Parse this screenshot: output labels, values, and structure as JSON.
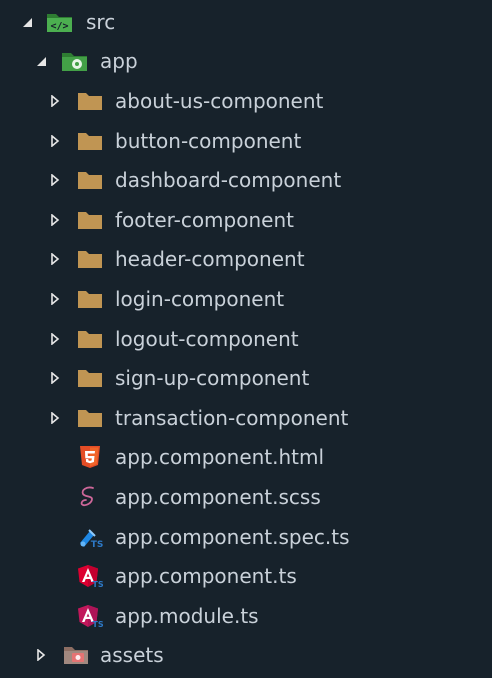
{
  "tree": {
    "root": {
      "label": "src",
      "icon": "src-folder-icon",
      "expanded": true
    },
    "app": {
      "label": "app",
      "icon": "app-folder-icon",
      "expanded": true
    },
    "folders": [
      {
        "label": "about-us-component",
        "icon": "folder-icon",
        "expanded": false
      },
      {
        "label": "button-component",
        "icon": "folder-icon",
        "expanded": false
      },
      {
        "label": "dashboard-component",
        "icon": "folder-icon",
        "expanded": false
      },
      {
        "label": "footer-component",
        "icon": "folder-icon",
        "expanded": false
      },
      {
        "label": "header-component",
        "icon": "folder-icon",
        "expanded": false
      },
      {
        "label": "login-component",
        "icon": "folder-icon",
        "expanded": false
      },
      {
        "label": "logout-component",
        "icon": "folder-icon",
        "expanded": false
      },
      {
        "label": "sign-up-component",
        "icon": "folder-icon",
        "expanded": false
      },
      {
        "label": "transaction-component",
        "icon": "folder-icon",
        "expanded": false
      }
    ],
    "files": [
      {
        "label": "app.component.html",
        "icon": "html5-icon"
      },
      {
        "label": "app.component.scss",
        "icon": "sass-icon"
      },
      {
        "label": "app.component.spec.ts",
        "icon": "test-spec-icon"
      },
      {
        "label": "app.component.ts",
        "icon": "angular-component-icon"
      },
      {
        "label": "app.module.ts",
        "icon": "angular-module-icon"
      }
    ],
    "assets": {
      "label": "assets",
      "icon": "assets-folder-icon",
      "expanded": false
    }
  },
  "colors": {
    "background": "#17222b",
    "text": "#c9d1d9",
    "chevron": "#e6e6e6",
    "folder": "#c09553",
    "src_folder": "#4caf50",
    "html": "#e44d26",
    "sass": "#cd6799",
    "angular": "#dd0031",
    "angular_module": "#c2185b",
    "ts_badge": "#2d79c7"
  }
}
